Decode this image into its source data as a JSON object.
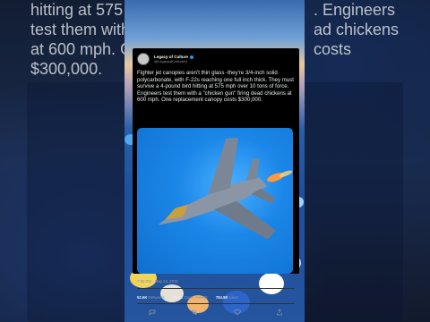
{
  "background": {
    "overlay_text_lines": [
      "hitting at 575",
      "test them with",
      "at 600 mph. O",
      "$300,000.",
      ". Engineers",
      "ad chickens",
      "costs"
    ]
  },
  "tweet": {
    "display_name": "Legacy of Culture",
    "handle": "@LegacyofCultureHi",
    "text": "Fighter jet canopies aren't thin glass -they're 3/4-inch solid polycarbonate, with F-22s reaching one full inch thick. They must survive a 4-pound bird hitting at 575 mph over 10 tons of force. Engineers test them with a \"chicken gun\" firing dead chickens at 600 mph. One replacement canopy costs $300,000.",
    "timestamp": "7:55 PM · May 24, 2025",
    "stats": {
      "retweets_value": "52.6K",
      "retweets_label": "Retweets",
      "quotes_value": "28.9K",
      "quotes_label": "Quote Tweets",
      "likes_value": "784.8K",
      "likes_label": "Likes"
    }
  },
  "colors": {
    "tweet_bg": "#000000",
    "verified_badge": "#1d9bf0",
    "media_sky": "#1b87e8"
  },
  "icons": {
    "reply": "reply-icon",
    "retweet": "retweet-icon",
    "like": "heart-icon",
    "share": "share-icon"
  }
}
